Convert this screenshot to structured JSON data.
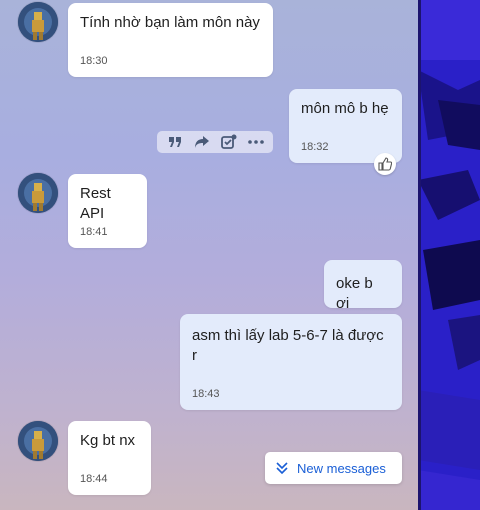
{
  "messages": [
    {
      "direction": "incoming",
      "text": "Tính nhờ bạn làm môn này",
      "time": "18:30"
    },
    {
      "direction": "outgoing",
      "text": "môn mô b hẹ",
      "time": "18:32"
    },
    {
      "direction": "incoming",
      "text": "Rest API",
      "time": "18:41"
    },
    {
      "direction": "outgoing",
      "text": "oke b ơi",
      "time": ""
    },
    {
      "direction": "outgoing",
      "text": "asm thì lấy lab 5-6-7 là được\nr",
      "time": "18:43"
    },
    {
      "direction": "incoming",
      "text": "Kg bt nx",
      "time": "18:44"
    }
  ],
  "message_toolbar": {
    "icons": [
      "quote-icon",
      "forward-icon",
      "edit-task-icon",
      "more-icon"
    ]
  },
  "reaction": {
    "icon": "thumbs-up-icon"
  },
  "new_messages_button": {
    "label": "New messages",
    "icon": "double-chevron-down-icon"
  },
  "colors": {
    "incoming_bubble": "#ffffff",
    "outgoing_bubble": "#e3ebfb",
    "accent": "#1a5fd6"
  }
}
